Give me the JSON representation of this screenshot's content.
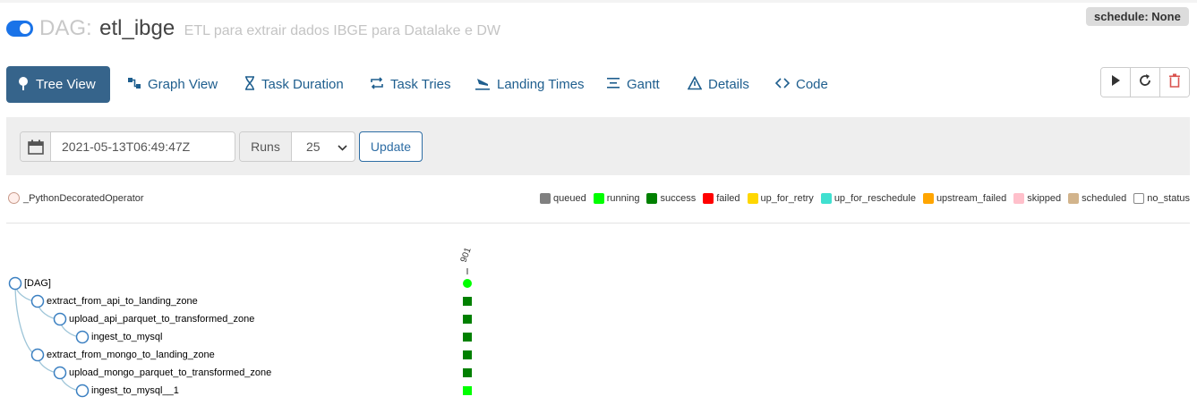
{
  "header": {
    "dag_prefix": "DAG:",
    "dag_id": "etl_ibge",
    "description": "ETL para extrair dados IBGE para Datalake e DW",
    "schedule_label": "schedule: None",
    "paused": false
  },
  "nav": {
    "tabs": [
      {
        "label": "Tree View",
        "icon": "tree-icon",
        "active": true
      },
      {
        "label": "Graph View",
        "icon": "graph-icon",
        "active": false
      },
      {
        "label": "Task Duration",
        "icon": "hourglass-icon",
        "active": false
      },
      {
        "label": "Task Tries",
        "icon": "repeat-icon",
        "active": false
      },
      {
        "label": "Landing Times",
        "icon": "plane-landing-icon",
        "active": false
      },
      {
        "label": "Gantt",
        "icon": "gantt-icon",
        "active": false
      },
      {
        "label": "Details",
        "icon": "warning-triangle-icon",
        "active": false
      },
      {
        "label": "Code",
        "icon": "code-icon",
        "active": false
      }
    ],
    "actions": [
      {
        "icon": "play-icon",
        "color": "#333333"
      },
      {
        "icon": "refresh-icon",
        "color": "#333333"
      },
      {
        "icon": "trash-icon",
        "color": "#d9534f"
      }
    ]
  },
  "form": {
    "date_value": "2021-05-13T06:49:47Z",
    "runs_label": "Runs",
    "runs_value": "25",
    "update_label": "Update"
  },
  "legend": {
    "operator": {
      "label": "_PythonDecoratedOperator",
      "color": "#ffefeb"
    },
    "states": [
      {
        "label": "queued",
        "color": "#808080"
      },
      {
        "label": "running",
        "color": "#00ff00"
      },
      {
        "label": "success",
        "color": "#008000"
      },
      {
        "label": "failed",
        "color": "#ff0000"
      },
      {
        "label": "up_for_retry",
        "color": "#ffd700"
      },
      {
        "label": "up_for_reschedule",
        "color": "#40e0d0"
      },
      {
        "label": "upstream_failed",
        "color": "#ffa500"
      },
      {
        "label": "skipped",
        "color": "#ffc0cb"
      },
      {
        "label": "scheduled",
        "color": "#d2b48c"
      },
      {
        "label": "no_status",
        "color": "#ffffff"
      }
    ]
  },
  "tree": {
    "run_label": "901",
    "nodes": [
      {
        "label": "[DAG]",
        "depth": 0,
        "state": "running"
      },
      {
        "label": "extract_from_api_to_landing_zone",
        "depth": 1,
        "state": "success"
      },
      {
        "label": "upload_api_parquet_to_transformed_zone",
        "depth": 2,
        "state": "success"
      },
      {
        "label": "ingest_to_mysql",
        "depth": 3,
        "state": "success"
      },
      {
        "label": "extract_from_mongo_to_landing_zone",
        "depth": 1,
        "state": "success"
      },
      {
        "label": "upload_mongo_parquet_to_transformed_zone",
        "depth": 2,
        "state": "success"
      },
      {
        "label": "ingest_to_mysql__1",
        "depth": 3,
        "state": "running"
      }
    ]
  }
}
